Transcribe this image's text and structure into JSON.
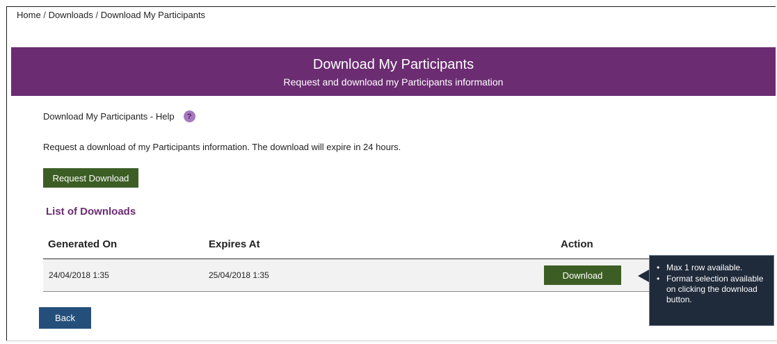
{
  "breadcrumb": {
    "items": [
      "Home",
      "Downloads",
      "Download My Participants"
    ],
    "separator": "/"
  },
  "header": {
    "title": "Download My Participants",
    "subtitle": "Request and download my Participants information",
    "background": "#6b2c72"
  },
  "help": {
    "label": "Download My Participants - Help",
    "icon": "question-icon",
    "icon_glyph": "?"
  },
  "intro_text": "Request a download of my Participants information. The download will expire in 24 hours.",
  "request_button": {
    "label": "Request Download",
    "color": "#3c5e25"
  },
  "downloads": {
    "heading": "List of Downloads",
    "columns": [
      "Generated On",
      "Expires At",
      "Action"
    ],
    "rows": [
      {
        "generated_on": "24/04/2018 1:35",
        "expires_at": "25/04/2018 1:35",
        "action_label": "Download"
      }
    ]
  },
  "back_button": {
    "label": "Back",
    "color": "#254f7b"
  },
  "tooltip": {
    "bullets": [
      "Max 1 row available.",
      "Format selection available on clicking the download button."
    ],
    "bullet_glyph": "•"
  }
}
